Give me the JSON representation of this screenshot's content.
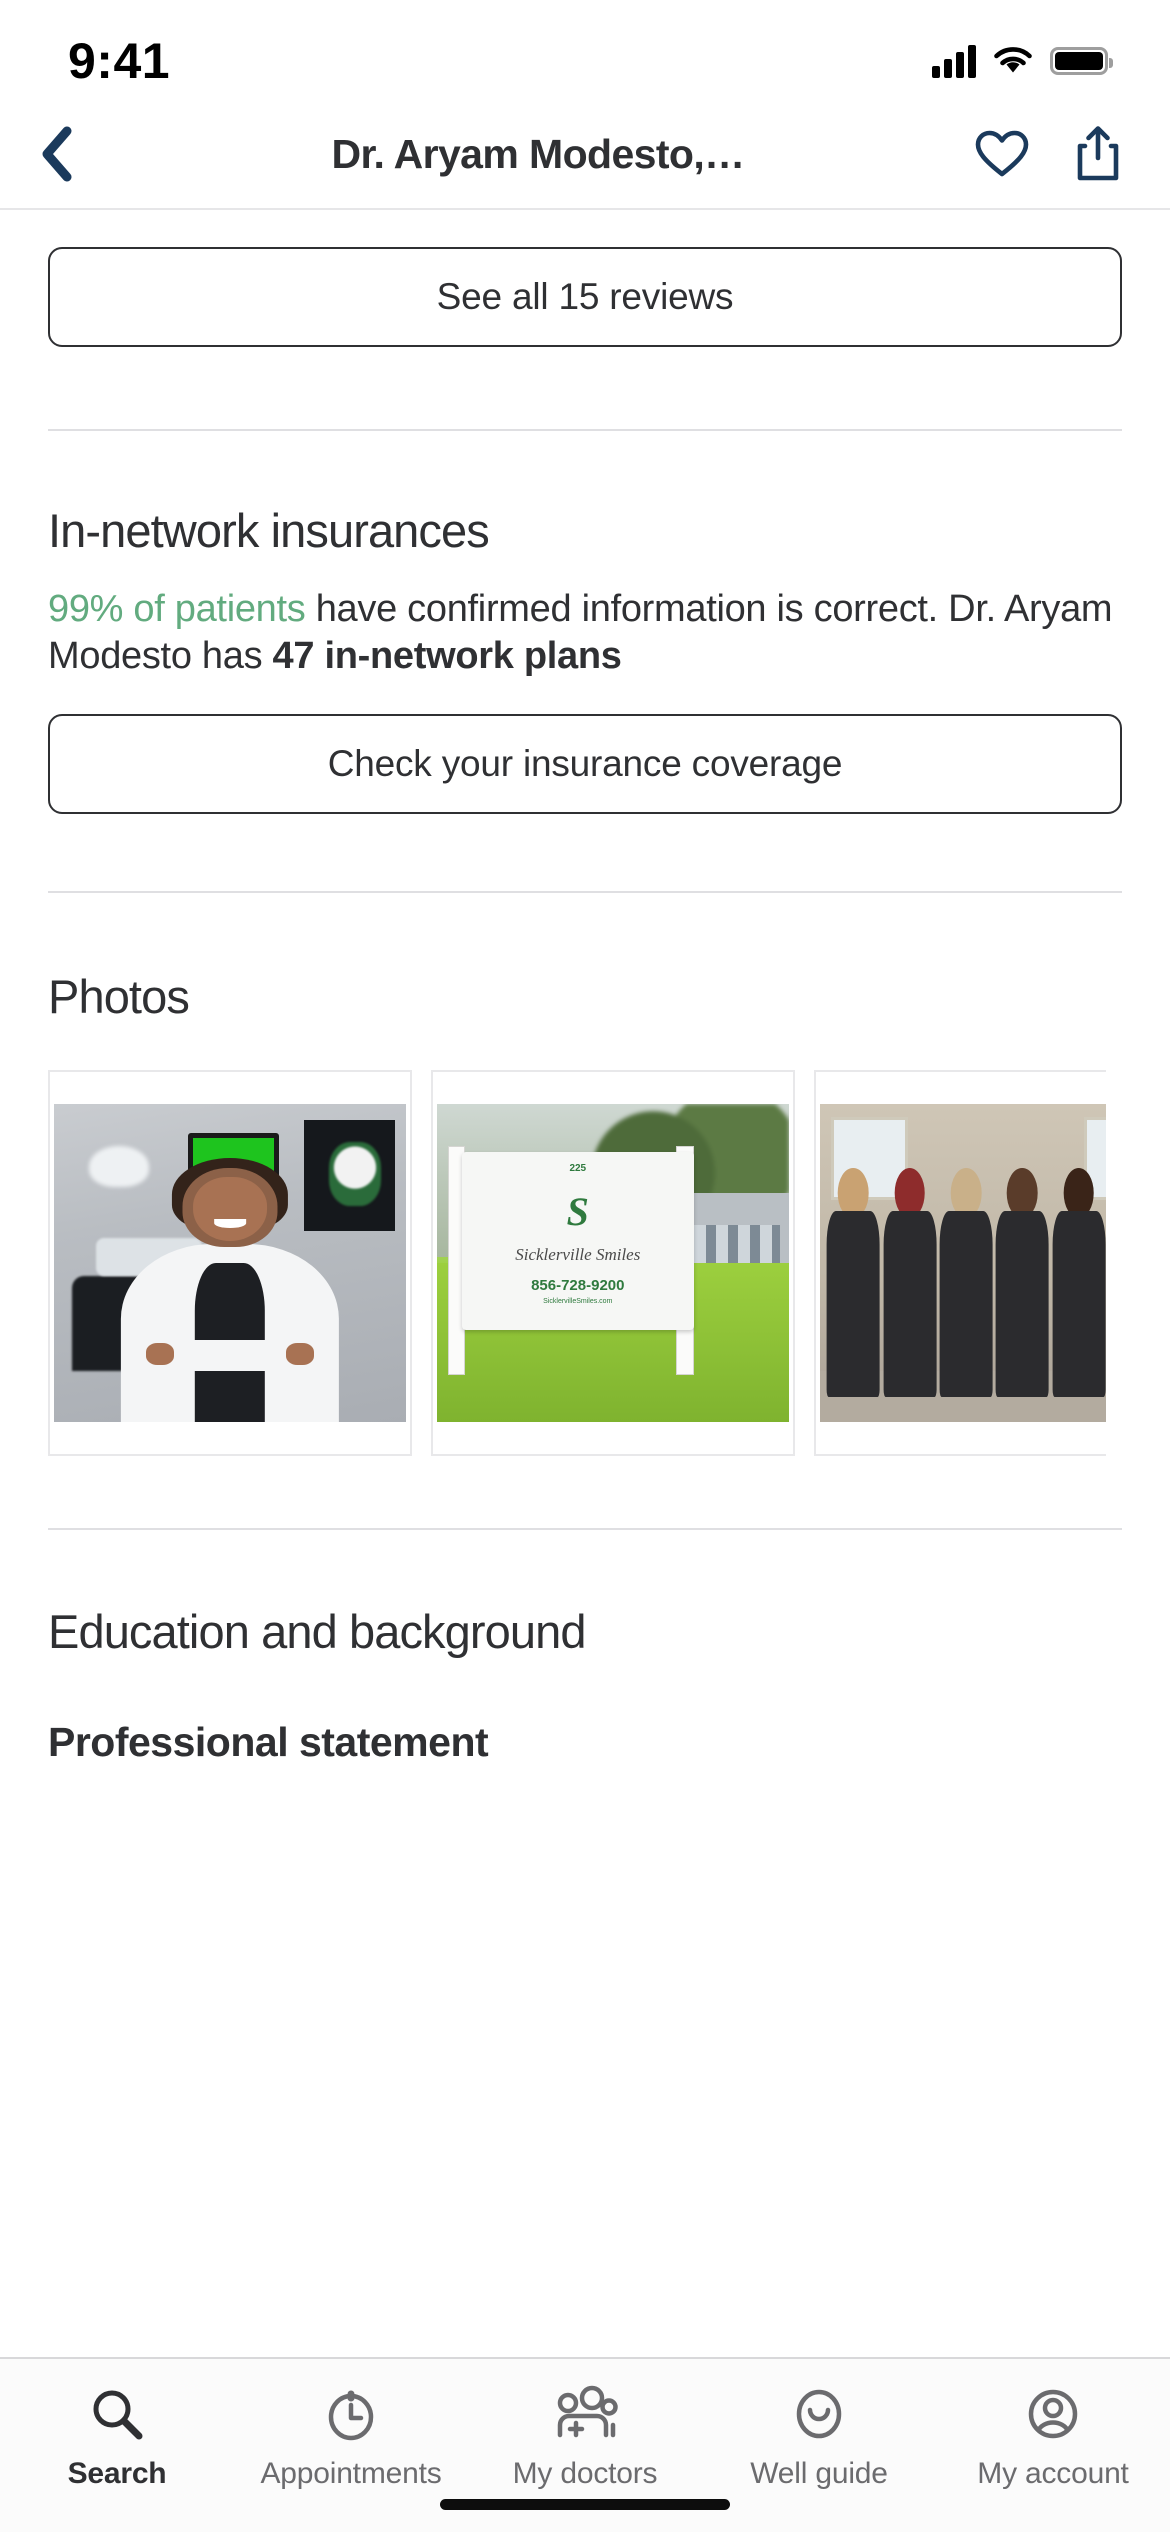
{
  "status_bar": {
    "time": "9:41",
    "signal_icon": "cellular-signal-icon",
    "wifi_icon": "wifi-icon",
    "battery_icon": "battery-full-icon"
  },
  "nav": {
    "back_icon": "chevron-left-icon",
    "title": "Dr. Aryam Modesto,…",
    "favorite_icon": "heart-outline-icon",
    "share_icon": "share-icon",
    "accent_color": "#1b3a5c"
  },
  "reviews": {
    "button_label": "See all 15 reviews",
    "count": 15
  },
  "insurance": {
    "heading": "In-network insurances",
    "body_highlight": "99% of patients",
    "body_middle": " have confirmed information is correct. Dr. Aryam Modesto has ",
    "body_bold": "47 in-network plans",
    "highlight_color": "#62ab7f",
    "button_label": "Check your insurance coverage"
  },
  "photos": {
    "heading": "Photos",
    "items": [
      {
        "name": "doctor-portrait-photo",
        "alt": "Dr. Aryam Modesto in white coat inside dental office"
      },
      {
        "name": "office-sign-photo",
        "alt": "Sicklerville Smiles office sign",
        "sign_address": "225",
        "sign_name": "Sicklerville Smiles",
        "sign_phone": "856-728-9200",
        "sign_web": "SicklervilleSmiles.com"
      },
      {
        "name": "staff-team-photo",
        "alt": "Practice staff team in dark uniforms"
      }
    ]
  },
  "education": {
    "heading": "Education and background",
    "subheading": "Professional statement"
  },
  "tab_bar": {
    "items": [
      {
        "label": "Search",
        "icon": "search-icon",
        "active": true
      },
      {
        "label": "Appointments",
        "icon": "clock-icon",
        "active": false
      },
      {
        "label": "My doctors",
        "icon": "people-plus-icon",
        "active": false
      },
      {
        "label": "Well guide",
        "icon": "smile-icon",
        "active": false
      },
      {
        "label": "My account",
        "icon": "account-circle-icon",
        "active": false
      }
    ],
    "active_color": "#2f3033",
    "inactive_color": "#6b6b6e"
  }
}
